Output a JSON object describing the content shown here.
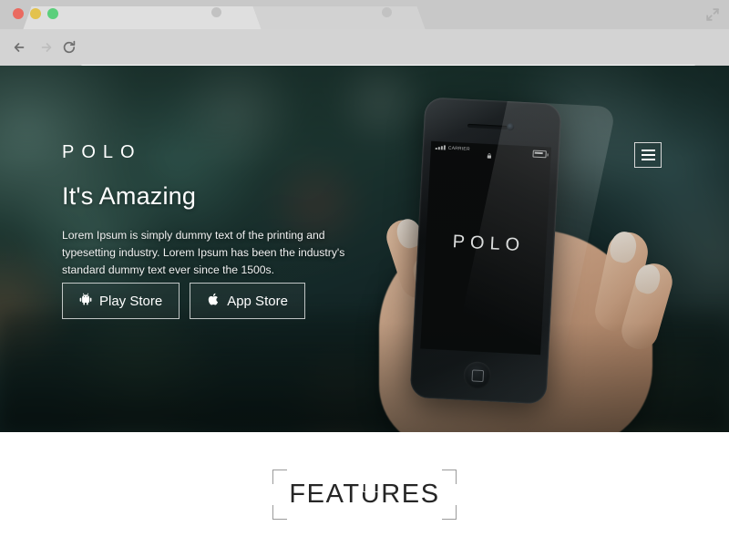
{
  "browser": {
    "traffic_lights": {
      "close_label": "close",
      "minimize_label": "minimize",
      "maximize_label": "maximize",
      "close_color": "#ea6a60",
      "minimize_color": "#e3c24d",
      "maximize_color": "#5bcf7c"
    },
    "tabs": [
      {
        "title": "",
        "active": true
      },
      {
        "title": "",
        "active": false
      }
    ],
    "toolbar": {
      "back_icon": "back-arrow-icon",
      "forward_icon": "forward-arrow-icon",
      "reload_icon": "reload-icon",
      "menu_icon": "hamburger-menu-icon",
      "expand_icon": "fullscreen-expand-icon"
    },
    "address_bar": {
      "value": "",
      "placeholder": "",
      "bookmark_icon": "star-icon"
    }
  },
  "page": {
    "header": {
      "logo": "POLO",
      "nav_toggle_icon": "hamburger-menu-icon"
    },
    "hero": {
      "title": "It's Amazing",
      "paragraph": "Lorem Ipsum is simply dummy text of the printing and typesetting industry. Lorem Ipsum has been the industry's standard dummy text ever since the 1500s.",
      "buttons": [
        {
          "label": "Play Store",
          "icon": "android-icon"
        },
        {
          "label": "App Store",
          "icon": "apple-icon"
        }
      ],
      "scroll_indicator_icon": "arrow-down-icon",
      "phone": {
        "status_bar": {
          "carrier": "CARRIER",
          "signal_icon": "signal-bars-icon",
          "lock_icon": "lock-icon",
          "battery_icon": "battery-icon"
        },
        "screen_logo": "POLO",
        "home_button_icon": "home-button-icon"
      }
    },
    "features": {
      "heading": "FEATURES"
    },
    "colors": {
      "hero_background": "#1d3530",
      "text_on_hero": "#ffffff",
      "features_background": "#ffffff",
      "features_heading": "#262626"
    }
  }
}
